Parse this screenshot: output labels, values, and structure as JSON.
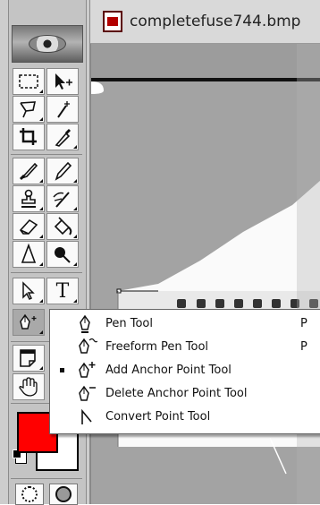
{
  "document": {
    "title": "completefuse744.bmp",
    "canvas_color": "#a3a3a3"
  },
  "toolbox": {
    "tools": [
      {
        "name": "marquee-tool-icon"
      },
      {
        "name": "move-tool-icon"
      },
      {
        "name": "lasso-tool-icon"
      },
      {
        "name": "magic-wand-tool-icon"
      },
      {
        "name": "crop-tool-icon"
      },
      {
        "name": "eyedropper-tool-icon"
      },
      {
        "name": "brush-tool-icon"
      },
      {
        "name": "pencil-tool-icon"
      },
      {
        "name": "clone-stamp-tool-icon"
      },
      {
        "name": "history-brush-tool-icon"
      },
      {
        "name": "eraser-tool-icon"
      },
      {
        "name": "paint-bucket-tool-icon"
      },
      {
        "name": "blur-tool-icon"
      },
      {
        "name": "burn-tool-icon"
      },
      {
        "name": "path-select-tool-icon"
      },
      {
        "name": "type-tool-icon"
      },
      {
        "name": "pen-tool-icon"
      },
      {
        "name": "notes-tool-icon"
      },
      {
        "name": "hand-tool-icon"
      }
    ],
    "type_glyph": "T",
    "foreground_color": "#ff0000",
    "background_color": "#ffffff"
  },
  "pen_flyout": {
    "items": [
      {
        "label": "Pen Tool",
        "shortcut": "P",
        "selected": false,
        "icon": "pen-icon"
      },
      {
        "label": "Freeform Pen Tool",
        "shortcut": "P",
        "selected": false,
        "icon": "freeform-pen-icon"
      },
      {
        "label": "Add Anchor Point Tool",
        "shortcut": "",
        "selected": true,
        "icon": "add-anchor-point-icon"
      },
      {
        "label": "Delete Anchor Point Tool",
        "shortcut": "",
        "selected": false,
        "icon": "delete-anchor-point-icon"
      },
      {
        "label": "Convert Point Tool",
        "shortcut": "",
        "selected": false,
        "icon": "convert-point-icon"
      }
    ]
  }
}
